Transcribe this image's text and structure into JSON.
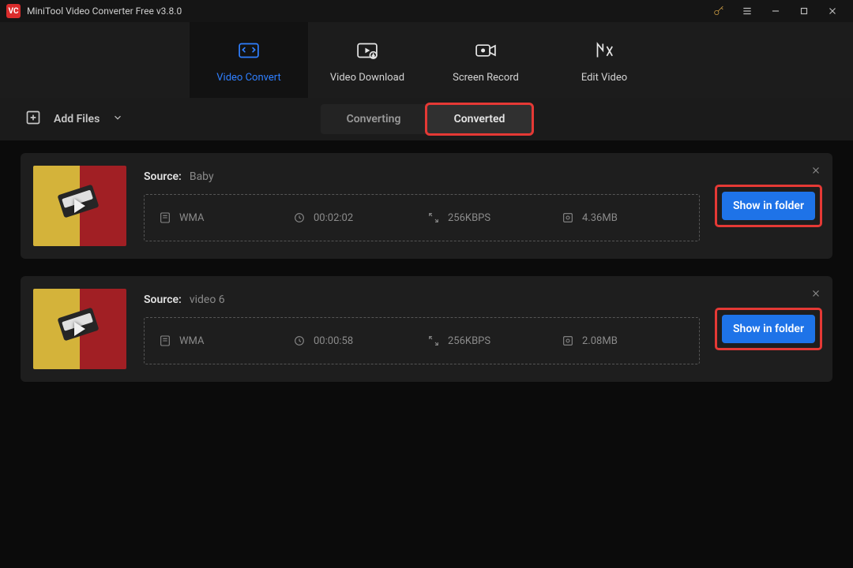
{
  "titlebar": {
    "title": "MiniTool Video Converter Free v3.8.0"
  },
  "tabs": [
    {
      "label": "Video Convert",
      "icon": "convert",
      "active": true
    },
    {
      "label": "Video Download",
      "icon": "download",
      "active": false
    },
    {
      "label": "Screen Record",
      "icon": "record",
      "active": false
    },
    {
      "label": "Edit Video",
      "icon": "edit",
      "active": false
    }
  ],
  "toolbar": {
    "add_files_label": "Add Files",
    "seg_converting": "Converting",
    "seg_converted": "Converted",
    "active_seg": "Converted"
  },
  "items": [
    {
      "source_label": "Source:",
      "source_name": "Baby",
      "format": "WMA",
      "duration": "00:02:02",
      "bitrate": "256KBPS",
      "size": "4.36MB",
      "action": "Show in folder"
    },
    {
      "source_label": "Source:",
      "source_name": "video 6",
      "format": "WMA",
      "duration": "00:00:58",
      "bitrate": "256KBPS",
      "size": "2.08MB",
      "action": "Show in folder"
    }
  ],
  "colors": {
    "accent": "#2f7fff",
    "primary_btn": "#1e73e8",
    "highlight": "#e53935"
  }
}
